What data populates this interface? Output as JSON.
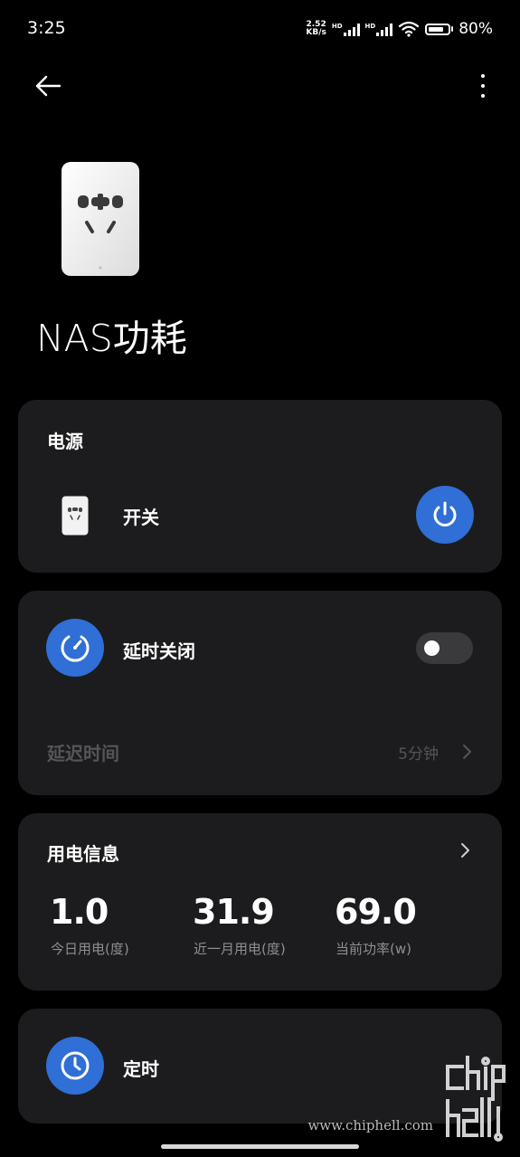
{
  "status": {
    "time": "3:25",
    "speed_value": "2.52",
    "speed_unit": "KB/s",
    "hd1": "HD",
    "hd2": "HD",
    "battery": "80%",
    "battery_level": 0.8
  },
  "header": {
    "back_icon": "arrow-left-icon",
    "more_icon": "more-vertical-icon"
  },
  "device": {
    "name": "NAS功耗",
    "image": "smart-plug-image"
  },
  "power_card": {
    "title": "电源",
    "switch_label": "开关",
    "power_icon": "power-icon",
    "accent": "#2f6fd6"
  },
  "delay_card": {
    "label": "延时关闭",
    "toggle_on": false,
    "delay_time_label": "延迟时间",
    "delay_time_value": "5分钟"
  },
  "usage_card": {
    "title": "用电信息",
    "stats": [
      {
        "value": "1.0",
        "label": "今日用电(度)"
      },
      {
        "value": "31.9",
        "label": "近一月用电(度)"
      },
      {
        "value": "69.0",
        "label": "当前功率(w)"
      }
    ]
  },
  "timer_card": {
    "label": "定时"
  },
  "watermark": {
    "text": "www.chiphell.com"
  }
}
